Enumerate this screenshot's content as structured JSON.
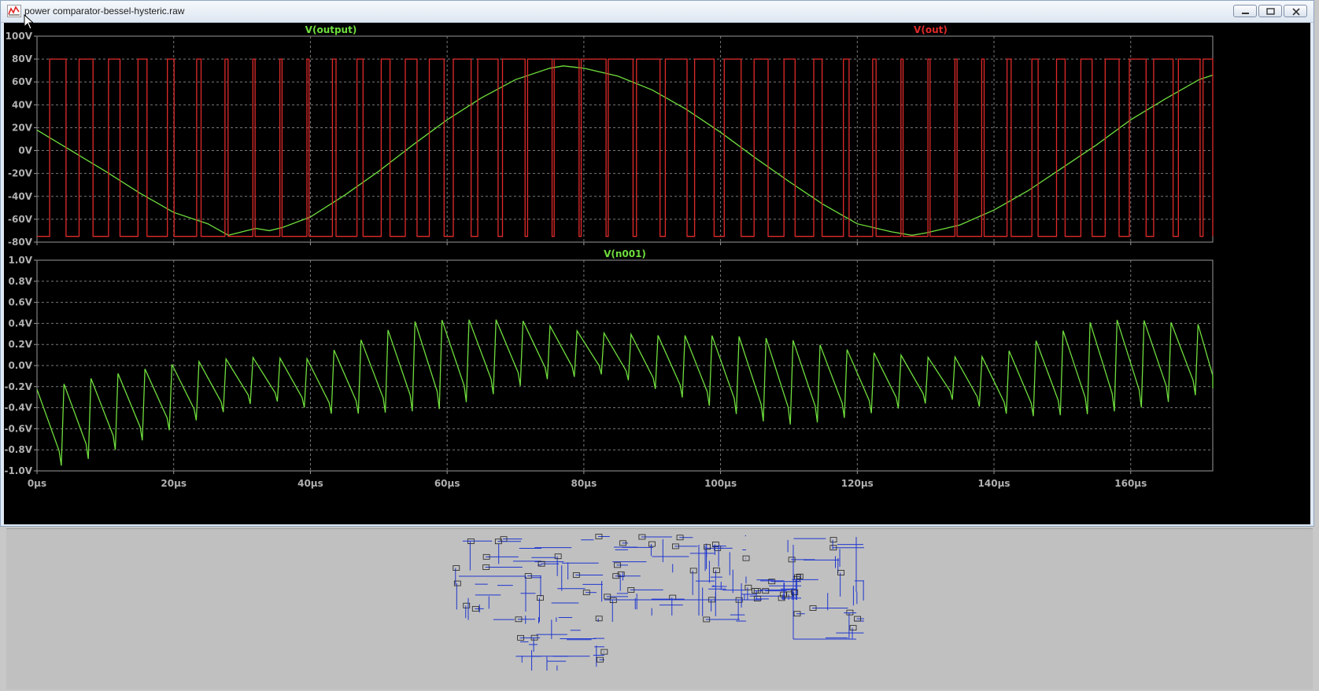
{
  "window": {
    "title": "power comparator-bessel-hysteric.raw"
  },
  "icons": {
    "app": "waveform-app-icon",
    "minimize": "minimize-icon",
    "maximize": "maximize-icon",
    "close": "close-icon",
    "cursor": "mouse-pointer-icon"
  },
  "colors": {
    "plot_background": "#000000",
    "grid": "#7a7a7a",
    "axis_text": "#b0b0b0",
    "trace_green": "#6fde3d",
    "trace_red": "#e02a2a",
    "schematic_wire": "#1f36d0",
    "panel_gray": "#c0c0c0"
  },
  "chart_data": [
    {
      "type": "line",
      "x_axis": {
        "unit": "µs",
        "range": [
          0,
          172
        ],
        "ticks": [
          0,
          20,
          40,
          60,
          80,
          100,
          120,
          140,
          160
        ],
        "tick_labels": [
          "0µs",
          "20µs",
          "40µs",
          "60µs",
          "80µs",
          "100µs",
          "120µs",
          "140µs",
          "160µs"
        ]
      },
      "y_axis": {
        "unit": "V",
        "range": [
          -80,
          100
        ],
        "ticks": [
          -80,
          -60,
          -40,
          -20,
          0,
          20,
          40,
          60,
          80,
          100
        ],
        "tick_labels": [
          "-80V",
          "-60V",
          "-40V",
          "-20V",
          "0V",
          "20V",
          "40V",
          "60V",
          "80V",
          "100V"
        ]
      },
      "grid": true,
      "series": [
        {
          "name": "V(output)",
          "color": "#6fde3d",
          "kind": "sampled",
          "x": [
            0,
            5,
            10,
            15,
            20,
            25,
            28,
            30,
            32,
            34,
            36,
            40,
            45,
            50,
            55,
            60,
            65,
            70,
            75,
            77,
            80,
            85,
            90,
            95,
            100,
            105,
            110,
            115,
            120,
            125,
            128,
            130,
            135,
            140,
            145,
            150,
            155,
            160,
            165,
            170,
            172
          ],
          "y": [
            18,
            0,
            -18,
            -37,
            -54,
            -64,
            -74,
            -71,
            -68,
            -70,
            -67,
            -58,
            -39,
            -18,
            5,
            27,
            46,
            62,
            72,
            74,
            72,
            65,
            53,
            36,
            16,
            -6,
            -27,
            -47,
            -64,
            -71,
            -74,
            -72,
            -65,
            -52,
            -35,
            -15,
            5,
            27,
            45,
            62,
            66
          ]
        },
        {
          "name": "V(out)",
          "color": "#e02a2a",
          "kind": "pwm_square",
          "low": -75,
          "high": 80,
          "period": 3.95,
          "note_shape": "pulse width follows V(output)"
        }
      ]
    },
    {
      "type": "line",
      "x_axis": {
        "unit": "µs",
        "range": [
          0,
          172
        ],
        "ticks": [
          0,
          20,
          40,
          60,
          80,
          100,
          120,
          140,
          160
        ],
        "tick_labels": [
          "0µs",
          "20µs",
          "40µs",
          "60µs",
          "80µs",
          "100µs",
          "120µs",
          "140µs",
          "160µs"
        ]
      },
      "y_axis": {
        "unit": "V",
        "range": [
          -1.0,
          1.0
        ],
        "ticks": [
          -1.0,
          -0.8,
          -0.6,
          -0.4,
          -0.2,
          0.0,
          0.2,
          0.4,
          0.6,
          0.8,
          1.0
        ],
        "tick_labels": [
          "-1.0V",
          "-0.8V",
          "-0.6V",
          "-0.4V",
          "-0.2V",
          "0.0V",
          "0.2V",
          "0.4V",
          "0.6V",
          "0.8V",
          "1.0V"
        ]
      },
      "grid": true,
      "series": [
        {
          "name": "V(n001)",
          "color": "#6fde3d",
          "kind": "sawtooth_envelope",
          "envelope_x": [
            0,
            10,
            20,
            30,
            40,
            50,
            55,
            60,
            70,
            80,
            90,
            100,
            105,
            110,
            120,
            130,
            140,
            150,
            155,
            160,
            170,
            172
          ],
          "envelope_amp": [
            0.68,
            0.6,
            0.48,
            0.36,
            0.48,
            0.68,
            0.76,
            0.7,
            0.52,
            0.36,
            0.52,
            0.7,
            0.76,
            0.72,
            0.52,
            0.36,
            0.52,
            0.72,
            0.78,
            0.74,
            0.55,
            0.5
          ],
          "center_x": [
            0,
            20,
            30,
            40,
            55,
            70,
            80,
            90,
            105,
            120,
            130,
            140,
            155,
            172
          ],
          "center_y": [
            -0.6,
            -0.25,
            -0.12,
            -0.2,
            0.0,
            0.15,
            0.12,
            0.0,
            -0.15,
            -0.15,
            -0.12,
            -0.2,
            0.0,
            0.1
          ]
        }
      ]
    }
  ]
}
